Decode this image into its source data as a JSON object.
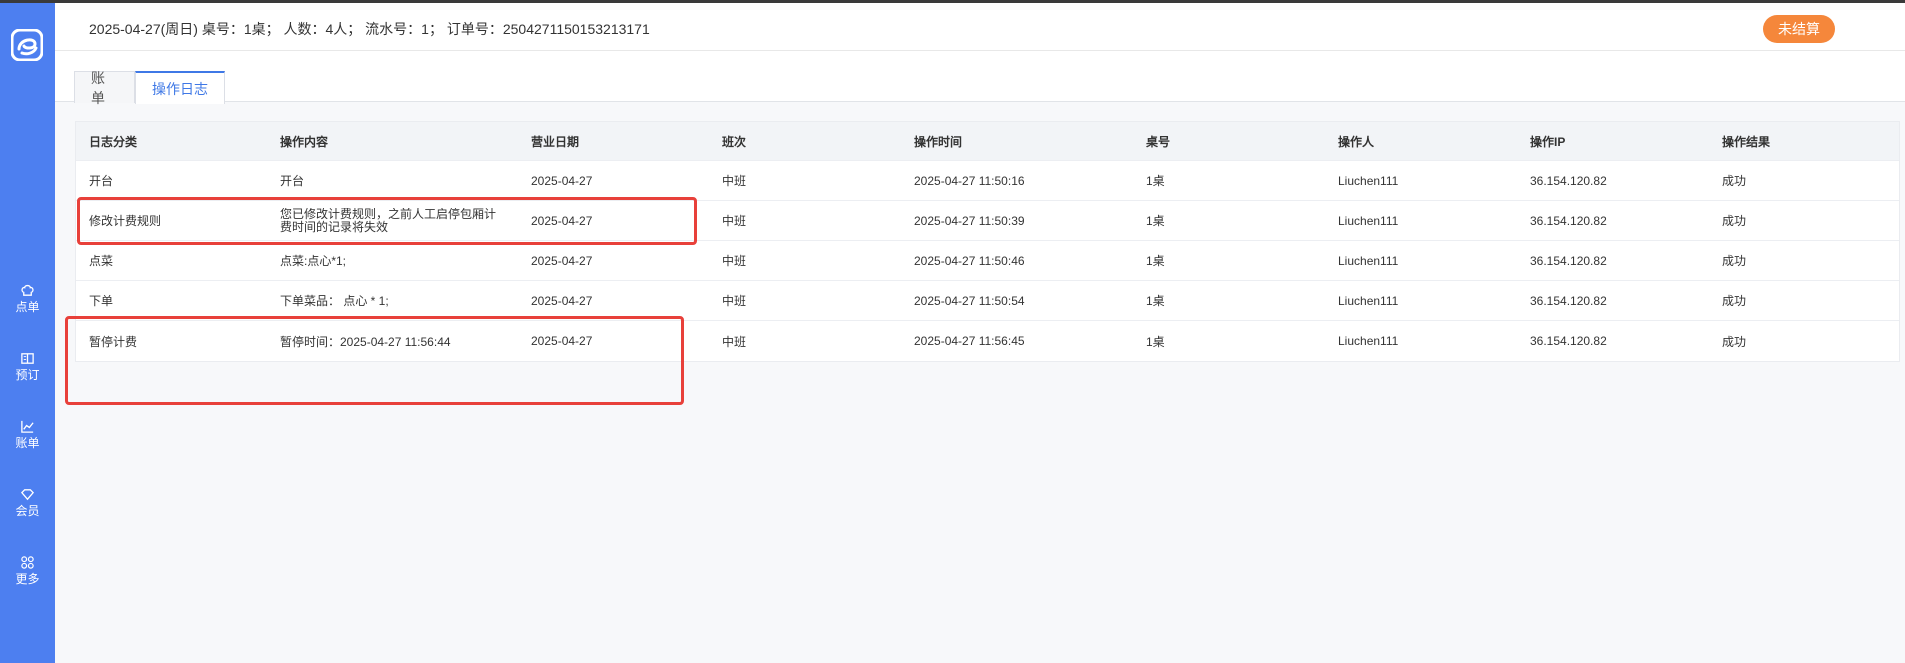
{
  "header": {
    "order_info": "2025-04-27(周日)  桌号：1桌；  人数：4人；   流水号：1；   订单号：2504271150153213171",
    "status_badge": "未结算"
  },
  "sidebar": {
    "items": [
      {
        "label": "点单",
        "icon": "chef-hat-icon"
      },
      {
        "label": "预订",
        "icon": "book-icon"
      },
      {
        "label": "账单",
        "icon": "chart-icon"
      },
      {
        "label": "会员",
        "icon": "diamond-icon"
      },
      {
        "label": "更多",
        "icon": "grid-icon"
      }
    ]
  },
  "tabs": [
    {
      "label": "账单",
      "active": false
    },
    {
      "label": "操作日志",
      "active": true
    }
  ],
  "table": {
    "columns": [
      "日志分类",
      "操作内容",
      "营业日期",
      "班次",
      "操作时间",
      "桌号",
      "操作人",
      "操作IP",
      "操作结果"
    ],
    "rows": [
      [
        "开台",
        "开台",
        "2025-04-27",
        "中班",
        "2025-04-27 11:50:16",
        "1桌",
        "Liuchen111",
        "36.154.120.82",
        "成功"
      ],
      [
        "修改计费规则",
        "您已修改计费规则，之前人工启停包厢计费时间的记录将失效",
        "2025-04-27",
        "中班",
        "2025-04-27 11:50:39",
        "1桌",
        "Liuchen111",
        "36.154.120.82",
        "成功"
      ],
      [
        "点菜",
        "点菜:点心*1;",
        "2025-04-27",
        "中班",
        "2025-04-27 11:50:46",
        "1桌",
        "Liuchen111",
        "36.154.120.82",
        "成功"
      ],
      [
        "下单",
        "下单菜品： 点心 * 1;",
        "2025-04-27",
        "中班",
        "2025-04-27 11:50:54",
        "1桌",
        "Liuchen111",
        "36.154.120.82",
        "成功"
      ],
      [
        "暂停计费",
        "暂停时间：2025-04-27 11:56:44",
        "2025-04-27",
        "中班",
        "2025-04-27 11:56:45",
        "1桌",
        "Liuchen111",
        "36.154.120.82",
        "成功"
      ]
    ]
  },
  "colors": {
    "sidebar": "#4d7ff0",
    "accent": "#3f78e6",
    "badge": "#f5873b",
    "highlight": "#e8403a"
  }
}
